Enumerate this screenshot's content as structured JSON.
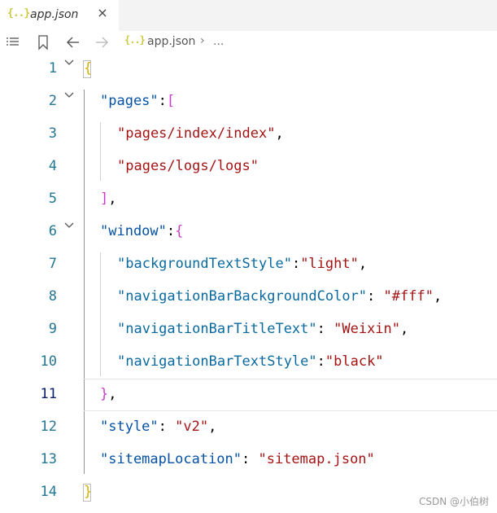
{
  "tab": {
    "icon": "{..}",
    "icon_name": "json-file-icon",
    "label": "app.json",
    "close": "×"
  },
  "breadcrumb": {
    "icon": "{..}",
    "file": "app.json",
    "separator": "›",
    "more": "..."
  },
  "toolbar": {
    "icons": [
      "list-icon",
      "bookmark-icon",
      "arrow-left-icon",
      "arrow-right-icon"
    ]
  },
  "code_lines": [
    {
      "n": "1",
      "tokens": [
        [
          "{",
          "b1"
        ]
      ]
    },
    {
      "n": "2",
      "tokens": [
        [
          "\"pages\"",
          "key"
        ],
        [
          ":",
          "p"
        ],
        [
          "[",
          "b2"
        ]
      ]
    },
    {
      "n": "3",
      "tokens": [
        [
          "\"pages/index/index\"",
          "str"
        ],
        [
          ",",
          "p"
        ]
      ]
    },
    {
      "n": "4",
      "tokens": [
        [
          "\"pages/logs/logs\"",
          "str"
        ]
      ]
    },
    {
      "n": "5",
      "tokens": [
        [
          "]",
          "b2"
        ],
        [
          ",",
          "p"
        ]
      ]
    },
    {
      "n": "6",
      "tokens": [
        [
          "\"window\"",
          "key"
        ],
        [
          ":",
          "p"
        ],
        [
          "{",
          "b2"
        ]
      ]
    },
    {
      "n": "7",
      "tokens": [
        [
          "\"backgroundTextStyle\"",
          "key2"
        ],
        [
          ":",
          "p"
        ],
        [
          "\"light\"",
          "str"
        ],
        [
          ",",
          "p"
        ]
      ]
    },
    {
      "n": "8",
      "tokens": [
        [
          "\"navigationBarBackgroundColor\"",
          "key2"
        ],
        [
          ": ",
          "p"
        ],
        [
          "\"#fff\"",
          "str"
        ],
        [
          ",",
          "p"
        ]
      ]
    },
    {
      "n": "9",
      "tokens": [
        [
          "\"navigationBarTitleText\"",
          "key2"
        ],
        [
          ": ",
          "p"
        ],
        [
          "\"Weixin\"",
          "str"
        ],
        [
          ",",
          "p"
        ]
      ]
    },
    {
      "n": "10",
      "tokens": [
        [
          "\"navigationBarTextStyle\"",
          "key2"
        ],
        [
          ":",
          "p"
        ],
        [
          "\"black\"",
          "str"
        ]
      ]
    },
    {
      "n": "11",
      "tokens": [
        [
          "}",
          "b2"
        ],
        [
          ",",
          "p"
        ]
      ]
    },
    {
      "n": "12",
      "tokens": [
        [
          "\"style\"",
          "key"
        ],
        [
          ": ",
          "p"
        ],
        [
          "\"v2\"",
          "str"
        ],
        [
          ",",
          "p"
        ]
      ]
    },
    {
      "n": "13",
      "tokens": [
        [
          "\"sitemapLocation\"",
          "key"
        ],
        [
          ": ",
          "p"
        ],
        [
          "\"sitemap.json\"",
          "str"
        ]
      ]
    },
    {
      "n": "14",
      "tokens": [
        [
          "}",
          "b1"
        ]
      ]
    }
  ],
  "active_line": "11",
  "foldable_lines": [
    "1",
    "2",
    "6"
  ],
  "watermark": "CSDN @小伯树",
  "colors": {
    "line_number": "#237893",
    "active_line_number": "#0b216f",
    "key": "#0451a5",
    "string": "#a31515",
    "brace_level1": "#d4b000",
    "brace_level2": "#c93ccb",
    "json_icon": "#cbcb41"
  }
}
